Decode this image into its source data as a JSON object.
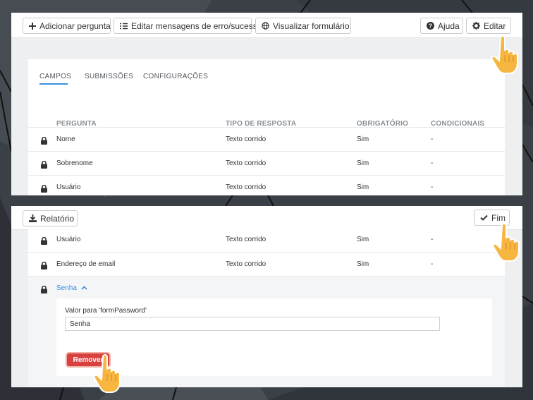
{
  "toolbar_top": {
    "add_question": "Adicionar pergunta",
    "edit_messages": "Editar mensagens de erro/sucesso",
    "preview_form": "Visualizar formulário",
    "help": "Ajuda",
    "edit": "Editar"
  },
  "tabs": {
    "fields": "CAMPOS",
    "submissions": "SUBMISSÕES",
    "settings": "CONFIGURAÇÕES"
  },
  "table": {
    "headers": {
      "question": "PERGUNTA",
      "response_type": "TIPO DE RESPOSTA",
      "required": "OBRIGATÓRIO",
      "conditionals": "CONDICIONAIS"
    },
    "rows_top": [
      {
        "question": "Nome",
        "type": "Texto corrido",
        "required": "Sim",
        "conditional": "-"
      },
      {
        "question": "Sobrenome",
        "type": "Texto corrido",
        "required": "Sim",
        "conditional": "-"
      },
      {
        "question": "Usuário",
        "type": "Texto corrido",
        "required": "Sim",
        "conditional": "-"
      }
    ],
    "rows_bottom": [
      {
        "question": "Usuário",
        "type": "Texto corrido",
        "required": "Sim",
        "conditional": "-"
      },
      {
        "question": "Endereço de email",
        "type": "Texto corrido",
        "required": "Sim",
        "conditional": "-"
      }
    ]
  },
  "toolbar_bottom": {
    "report": "Relatório",
    "done": "Fim"
  },
  "expanded_field": {
    "name": "Senha",
    "value_label": "Valor para 'formPassword'",
    "value": "Senha",
    "remove": "Remover"
  },
  "colors": {
    "accent": "#3d8fe0",
    "danger": "#d94141",
    "hand": "#f6b640"
  }
}
